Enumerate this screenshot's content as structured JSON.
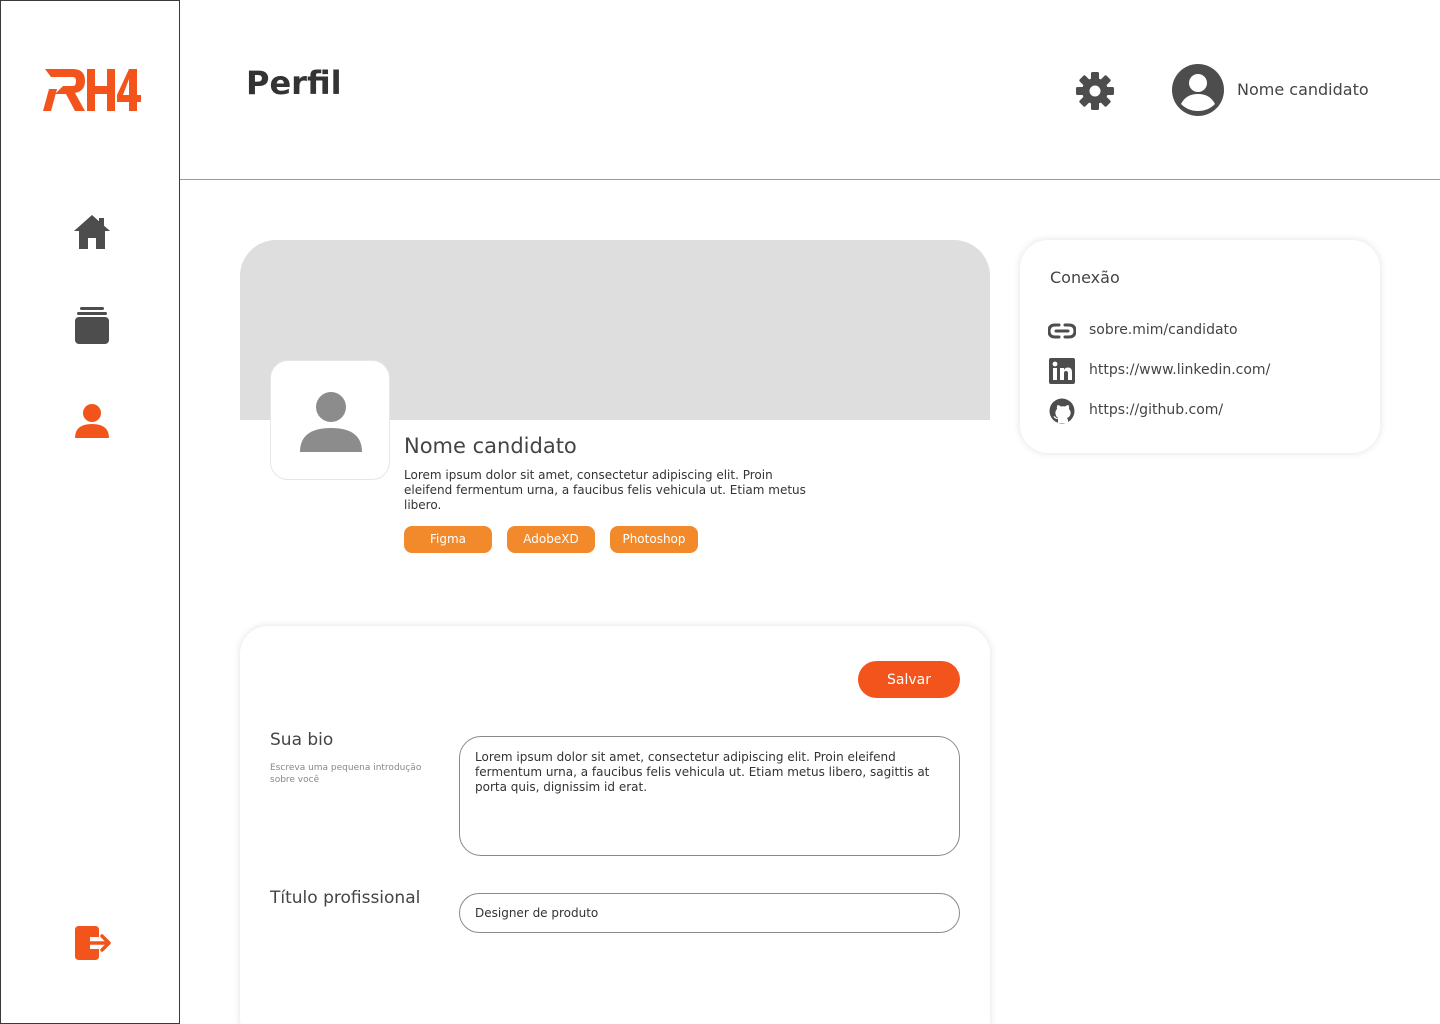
{
  "brand": {
    "logo_text": "RH4",
    "accent_color": "#f2541b",
    "tag_color": "#f28a2c"
  },
  "sidebar": {
    "items": [
      {
        "icon": "home-icon",
        "active": false
      },
      {
        "icon": "jobs-icon",
        "active": false
      },
      {
        "icon": "user-icon",
        "active": true
      }
    ],
    "logout_icon": "logout-icon"
  },
  "header": {
    "title": "Perfil",
    "settings_icon": "gear-icon",
    "user_name": "Nome candidato"
  },
  "profile": {
    "name": "Nome candidato",
    "description": "Lorem ipsum dolor sit amet, consectetur adipiscing elit. Proin eleifend fermentum urna, a faucibus felis vehicula ut. Etiam metus libero.",
    "skills": [
      "Figma",
      "AdobeXD",
      "Photoshop"
    ]
  },
  "connections": {
    "title": "Conexão",
    "links": [
      {
        "icon": "link-icon",
        "text": "sobre.mim/candidato"
      },
      {
        "icon": "linkedin-icon",
        "text": "https://www.linkedin.com/"
      },
      {
        "icon": "github-icon",
        "text": "https://github.com/"
      }
    ]
  },
  "form": {
    "save_label": "Salvar",
    "bio_label": "Sua bio",
    "bio_help": "Escreva uma pequena introdução sobre você",
    "bio_value": "Lorem ipsum dolor sit amet, consectetur adipiscing elit. Proin eleifend fermentum urna, a faucibus felis vehicula ut. Etiam metus libero, sagittis at porta quis, dignissim id erat.",
    "title_label": "Título profissional",
    "title_value": "Designer de produto"
  }
}
